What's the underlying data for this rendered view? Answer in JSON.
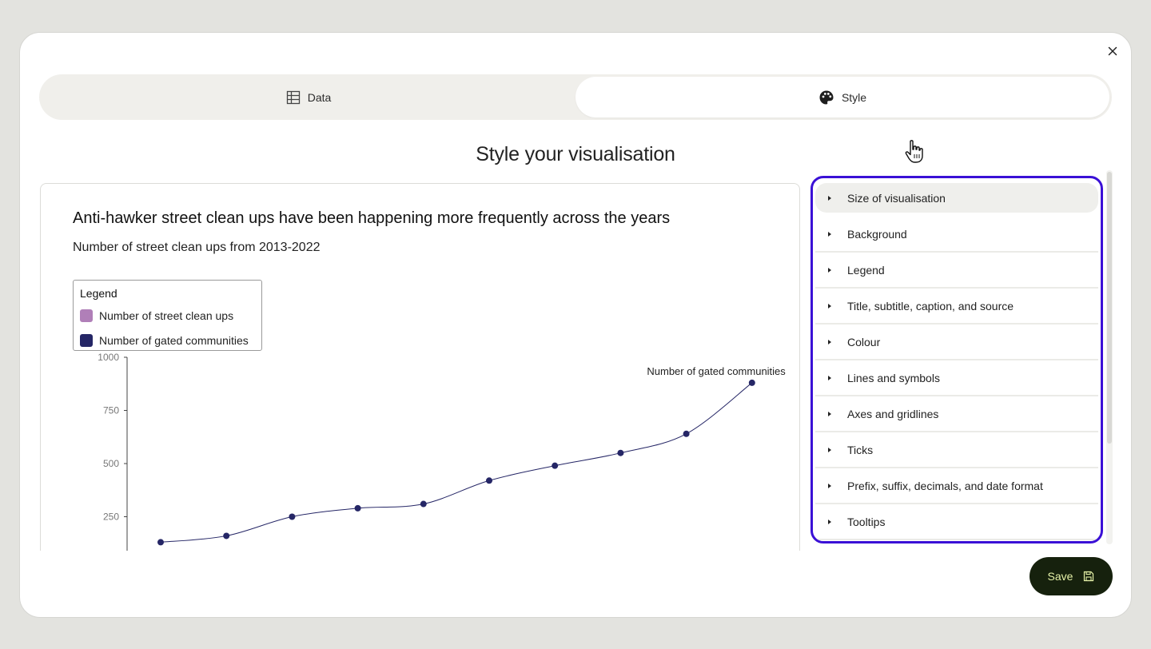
{
  "tabs": [
    {
      "label": "Data",
      "icon": "table-icon",
      "active": false
    },
    {
      "label": "Style",
      "icon": "palette-icon",
      "active": true
    }
  ],
  "page_title": "Style your visualisation",
  "chart": {
    "title": "Anti-hawker street clean ups have been happening more frequently across the years",
    "subtitle": "Number of street clean ups from 2013-2022",
    "legend": {
      "title": "Legend",
      "items": [
        {
          "label": "Number of street clean ups",
          "color": "#b07fb8"
        },
        {
          "label": "Number of gated communities",
          "color": "#252666"
        }
      ]
    },
    "series_label": "Number of gated communities"
  },
  "chart_data": {
    "type": "line",
    "y_ticks": [
      "1000",
      "750",
      "500",
      "250"
    ],
    "ylim": [
      0,
      1000
    ],
    "series": [
      {
        "name": "Number of gated communities",
        "color": "#252666",
        "values": [
          130,
          160,
          250,
          290,
          310,
          420,
          490,
          550,
          640,
          880
        ]
      }
    ]
  },
  "style_panel": {
    "items": [
      "Size of visualisation",
      "Background",
      "Legend",
      "Title, subtitle, caption, and source",
      "Colour",
      "Lines and symbols",
      "Axes and gridlines",
      "Ticks",
      "Prefix, suffix, decimals, and date format",
      "Tooltips"
    ]
  },
  "save_label": "Save",
  "colors": {
    "accent_border": "#3a10d6",
    "save_bg": "#16210d",
    "save_text": "#e6f2a8"
  }
}
